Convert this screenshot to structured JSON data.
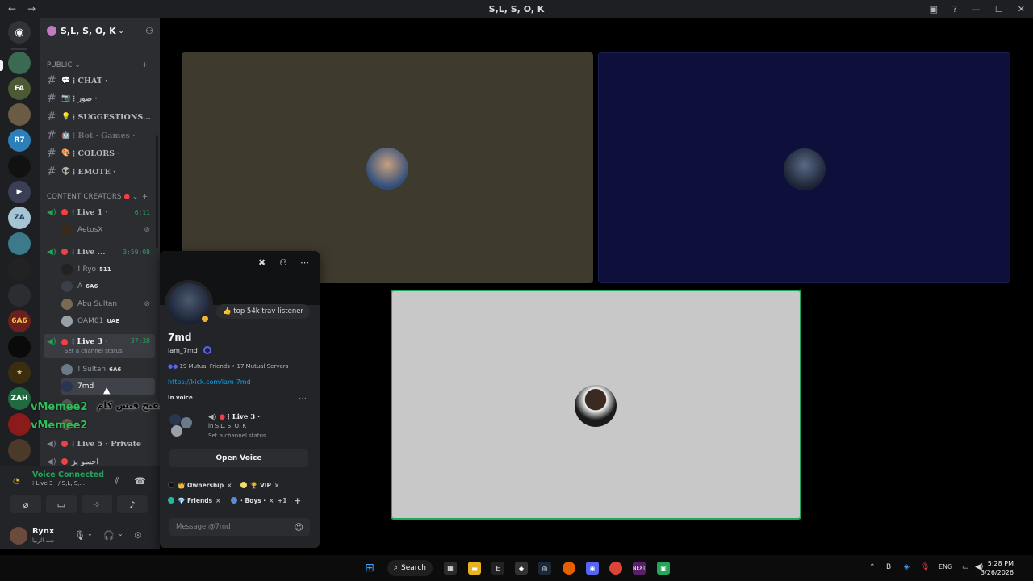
{
  "window": {
    "title": "S,L, S, O, K",
    "nav_back": "←",
    "nav_forward": "→"
  },
  "server": {
    "name": "S,L, S, O, K"
  },
  "sidebar": {
    "cat_public": "PUBLIC",
    "cat_creators": "CONTENT CREATORS",
    "channels": [
      {
        "emoji": "💬",
        "label": "⁞ CHAT ·"
      },
      {
        "emoji": "📷",
        "label": "⁞ صور ·"
      },
      {
        "emoji": "💡",
        "label": "⁞ SUGGESTIONS..."
      },
      {
        "emoji": "🤖",
        "label": "⁞ Bot · Games ·"
      },
      {
        "emoji": "🎨",
        "label": "⁞ COLORS ·"
      },
      {
        "emoji": "👽",
        "label": "⁞ EMOTE ·"
      }
    ],
    "voice": [
      {
        "label": "⁞ Live 1 ·",
        "timer": "6:11"
      },
      {
        "label": "⁞ Live ...",
        "timer": "3:59:08"
      },
      {
        "label": "⁞ Live 3 ·",
        "timer": "37:38",
        "status": "Set a channel status"
      },
      {
        "label": "⁞ Live 5 · Private"
      },
      {
        "label": "احسو بز"
      }
    ],
    "users": [
      {
        "name": "AetosX"
      },
      {
        "name": "! Ryo",
        "tag": "511"
      },
      {
        "name": "A",
        "tag": "6A6"
      },
      {
        "name": "Abu Sultan"
      },
      {
        "name": "OAM81",
        "tag": "UAE"
      },
      {
        "name": "! Sultan",
        "tag": "6A6"
      },
      {
        "name": "7md"
      }
    ]
  },
  "overlay": {
    "caption": "متى ناوي تفتح فيس كام",
    "user1": "vMemee2",
    "user2": "vMemee2"
  },
  "voice_panel": {
    "status": "Voice Connected",
    "channel": "⁞ Live 3 · / S,L, S,...",
    "user_name": "Rynx",
    "user_status": "مب الربيا"
  },
  "popout": {
    "custom_status": "👍 top 54k trav listener",
    "display_name": "7md",
    "username": "iam_7md",
    "mutual_friends": "19 Mutual Friends",
    "mutual_servers": "17 Mutual Servers",
    "link": "https://kick.com/iam-7md",
    "in_voice_label": "In voice",
    "voice_channel": "⁞ Live 3 ·",
    "voice_server": "in S,L, S, O, K",
    "voice_status": "Set a channel status",
    "open_voice": "Open Voice",
    "roles": [
      {
        "label": "👑 Ownership",
        "color": "#111214"
      },
      {
        "label": "🏆 VIP",
        "color": "#f0e068"
      },
      {
        "label": "💎 Friends",
        "color": "#1abc9c"
      },
      {
        "label": "· Boys ·",
        "color": "#5b8bd6"
      }
    ],
    "roles_more": "+1",
    "message_placeholder": "Message @7md"
  },
  "taskbar": {
    "search": "Search",
    "lang": "ENG",
    "time": "5:28 PM",
    "date": "3/26/2026"
  },
  "colors": {
    "tile1": "#3f3a2e",
    "tile2": "#0e0f3b",
    "tile3": "#c8c8c8",
    "speaking": "#23a55a"
  }
}
